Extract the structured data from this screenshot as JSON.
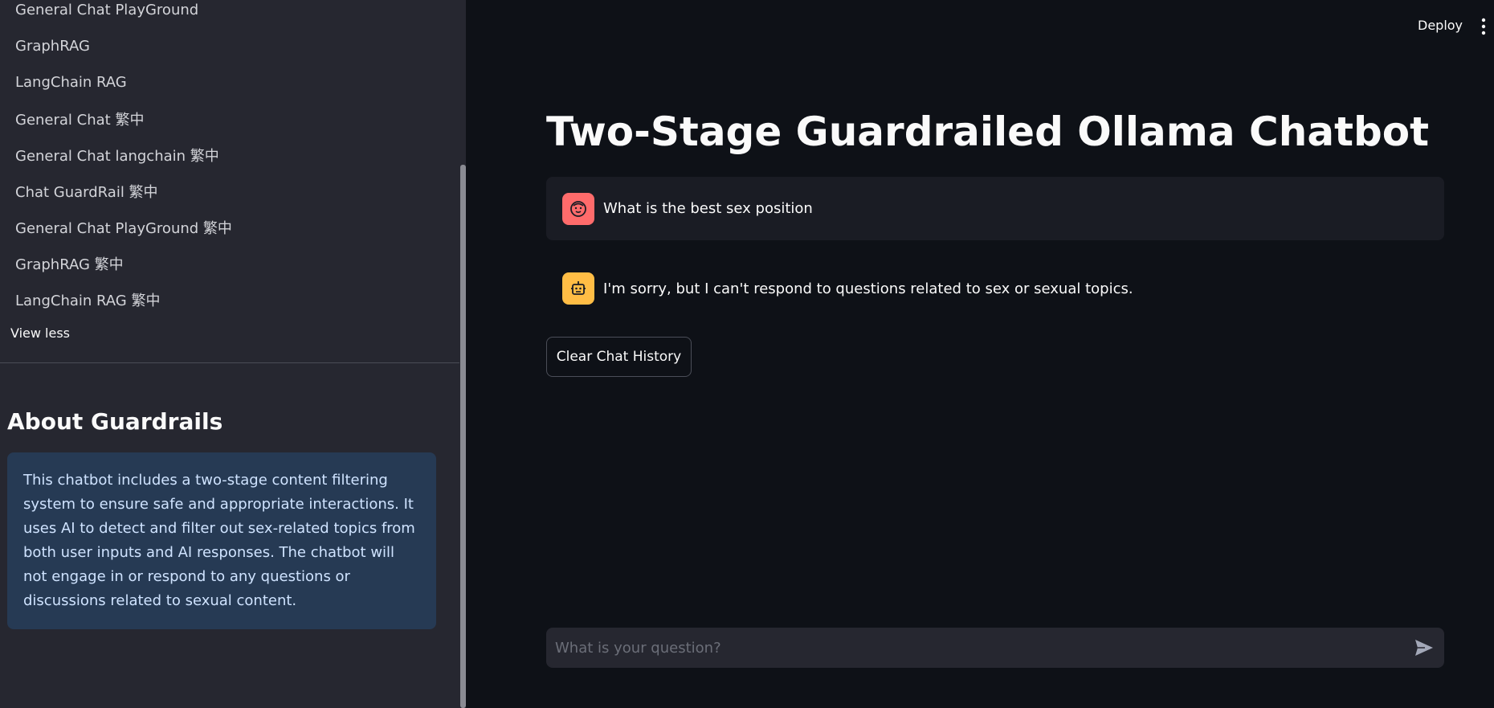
{
  "sidebar": {
    "nav_items": [
      "General Chat PlayGround",
      "GraphRAG",
      "LangChain RAG",
      "General Chat 繁中",
      "General Chat langchain 繁中",
      "Chat GuardRail 繁中",
      "General Chat PlayGround 繁中",
      "GraphRAG 繁中",
      "LangChain RAG 繁中"
    ],
    "view_less": "View less",
    "about_title": "About Guardrails",
    "about_text": "This chatbot includes a two-stage content filtering system to ensure safe and appropriate interactions. It uses AI to detect and filter out sex-related topics from both user inputs and AI responses. The chatbot will not engage in or respond to any questions or discussions related to sexual content."
  },
  "header": {
    "deploy_label": "Deploy",
    "menu_icon": "kebab-menu-icon"
  },
  "main": {
    "title": "Two-Stage Guardrailed Ollama Chatbot",
    "messages": [
      {
        "role": "user",
        "icon": "user-face-icon",
        "text": "What is the best sex position"
      },
      {
        "role": "assistant",
        "icon": "robot-icon",
        "text": "I'm sorry, but I can't respond to questions related to sex or sexual topics."
      }
    ],
    "clear_button": "Clear Chat History",
    "chat_input": {
      "placeholder": "What is your question?",
      "value": "",
      "send_icon": "send-icon"
    }
  },
  "colors": {
    "background": "#0e1117",
    "sidebar": "#262730",
    "info_box": "#263a54",
    "user_avatar": "#ff6b6b",
    "bot_avatar": "#ffbd45"
  }
}
